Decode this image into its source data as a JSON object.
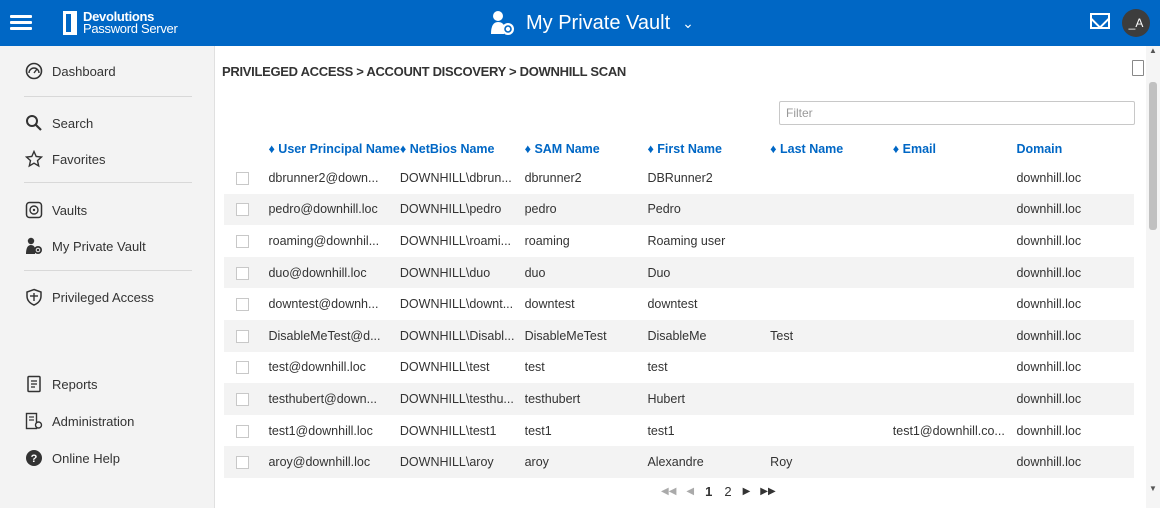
{
  "header": {
    "brand_line1": "Devolutions",
    "brand_line2": "Password Server",
    "vault_title": "My Private Vault",
    "avatar_initials": "_A",
    "color": "#0067c5"
  },
  "sidebar": {
    "items": [
      {
        "label": "Dashboard",
        "icon": "dashboard-icon"
      },
      {
        "label": "Search",
        "icon": "search-icon"
      },
      {
        "label": "Favorites",
        "icon": "star-icon"
      },
      {
        "label": "Vaults",
        "icon": "vault-icon"
      },
      {
        "label": "My Private Vault",
        "icon": "private-vault-icon"
      },
      {
        "label": "Privileged Access",
        "icon": "shield-icon"
      },
      {
        "label": "Reports",
        "icon": "report-icon"
      },
      {
        "label": "Administration",
        "icon": "administration-icon"
      },
      {
        "label": "Online Help",
        "icon": "help-icon"
      }
    ]
  },
  "main": {
    "breadcrumb": "PRIVILEGED ACCESS > ACCOUNT DISCOVERY > DOWNHILL SCAN",
    "filter_placeholder": "Filter",
    "columns": [
      "♦ User Principal Name",
      "♦ NetBios Name",
      "♦ SAM Name",
      "♦ First Name",
      "♦ Last Name",
      "♦ Email",
      "Domain"
    ],
    "rows": [
      [
        "dbrunner2@down...",
        "DOWNHILL\\dbrun...",
        "dbrunner2",
        "DBRunner2",
        "",
        "",
        "downhill.loc"
      ],
      [
        "pedro@downhill.loc",
        "DOWNHILL\\pedro",
        "pedro",
        "Pedro",
        "",
        "",
        "downhill.loc"
      ],
      [
        "roaming@downhil...",
        "DOWNHILL\\roami...",
        "roaming",
        "Roaming user",
        "",
        "",
        "downhill.loc"
      ],
      [
        "duo@downhill.loc",
        "DOWNHILL\\duo",
        "duo",
        "Duo",
        "",
        "",
        "downhill.loc"
      ],
      [
        "downtest@downh...",
        "DOWNHILL\\downt...",
        "downtest",
        "downtest",
        "",
        "",
        "downhill.loc"
      ],
      [
        "DisableMeTest@d...",
        "DOWNHILL\\Disabl...",
        "DisableMeTest",
        "DisableMe",
        "Test",
        "",
        "downhill.loc"
      ],
      [
        "test@downhill.loc",
        "DOWNHILL\\test",
        "test",
        "test",
        "",
        "",
        "downhill.loc"
      ],
      [
        "testhubert@down...",
        "DOWNHILL\\testhu...",
        "testhubert",
        "Hubert",
        "",
        "",
        "downhill.loc"
      ],
      [
        "test1@downhill.loc",
        "DOWNHILL\\test1",
        "test1",
        "test1",
        "",
        "test1@downhill.co...",
        "downhill.loc"
      ],
      [
        "aroy@downhill.loc",
        "DOWNHILL\\aroy",
        "aroy",
        "Alexandre",
        "Roy",
        "",
        "downhill.loc"
      ]
    ],
    "pager": {
      "first": "◀◀",
      "prev": "◀",
      "page1": "1",
      "page2": "2",
      "next": "▶",
      "last": "▶▶"
    }
  }
}
